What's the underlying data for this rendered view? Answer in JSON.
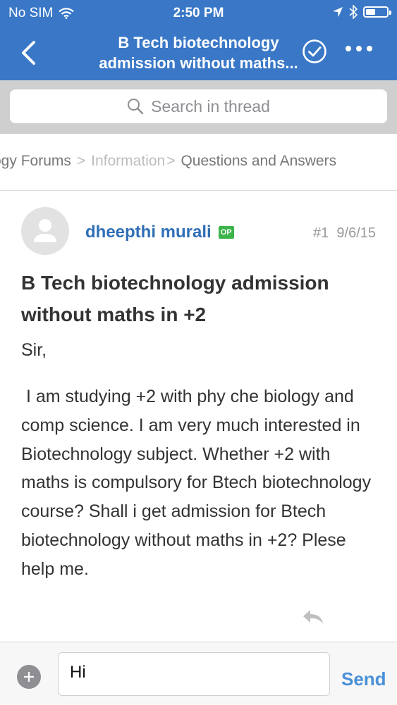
{
  "status": {
    "carrier": "No SIM",
    "time": "2:50 PM",
    "battery_level": 0.45
  },
  "nav": {
    "title_line1": "B Tech biotechnology",
    "title_line2": "admission without maths..."
  },
  "search": {
    "placeholder": "Search in thread"
  },
  "breadcrumb": {
    "item1": "ogy Forums",
    "item2": "Information",
    "item3": "Questions and Answers"
  },
  "post": {
    "author": "dheepthi murali",
    "op_badge": "OP",
    "number": "#1",
    "date": "9/6/15",
    "title": "B Tech biotechnology admission without maths in +2",
    "greeting": "Sir,",
    "body": " I am studying +2 with phy che biology and comp science. I am very much interested in Biotechnology subject. Whether +2 with maths is compulsory for Btech biotechnology course? Shall i get admission for Btech biotechnology without maths in +2? Plese help me."
  },
  "composer": {
    "input_value": "Hi",
    "send_label": "Send"
  },
  "icons": {
    "back": "chevron-left-icon",
    "check": "check-circle-icon",
    "more": "more-icon",
    "search": "search-icon",
    "reply": "reply-icon",
    "add": "plus-icon"
  },
  "colors": {
    "accent": "#3a78c7",
    "author": "#2f6fb7",
    "op_badge": "#3bb54a",
    "send": "#4a90d9"
  }
}
